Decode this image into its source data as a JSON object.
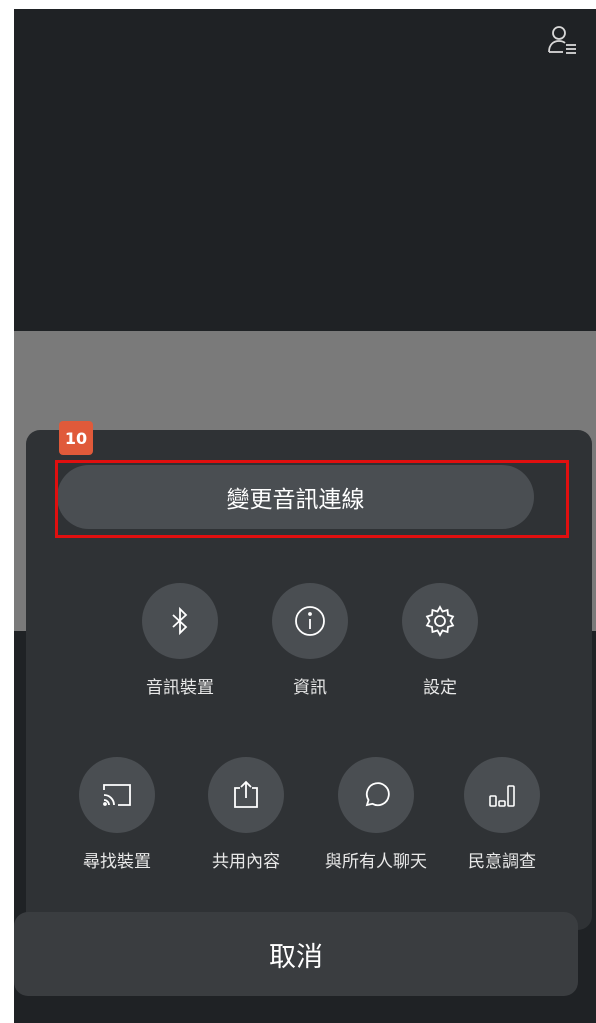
{
  "badge": "10",
  "primary_action": "變更音訊連線",
  "row1": [
    {
      "label": "音訊裝置",
      "icon": "bluetooth-icon"
    },
    {
      "label": "資訊",
      "icon": "info-icon"
    },
    {
      "label": "設定",
      "icon": "gear-icon"
    }
  ],
  "row2": [
    {
      "label": "尋找裝置",
      "icon": "cast-icon"
    },
    {
      "label": "共用內容",
      "icon": "share-icon"
    },
    {
      "label": "與所有人聊天",
      "icon": "chat-icon"
    },
    {
      "label": "民意調查",
      "icon": "poll-icon"
    }
  ],
  "cancel": "取消",
  "colors": {
    "highlight": "#e10f0f",
    "badge": "#e05a3a",
    "red_button": "#d34b3f"
  }
}
